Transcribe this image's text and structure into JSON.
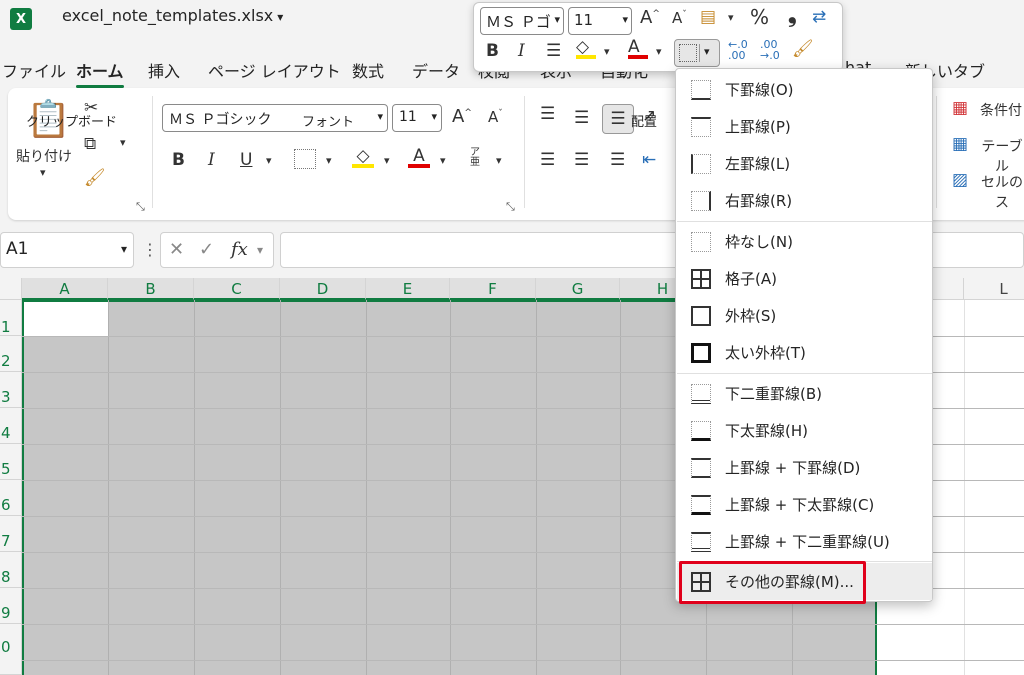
{
  "app": {
    "icon_letter": "X",
    "doc_title": "excel_note_templates.xlsx"
  },
  "tabs": [
    "ファイル",
    "ホーム",
    "挿入",
    "ページ レイアウト",
    "数式",
    "データ",
    "校閲",
    "表示",
    "自動化",
    "hat",
    "新しいタブ"
  ],
  "ribbon": {
    "clipboard_paste": "貼り付け",
    "clipboard_label": "クリップボード",
    "font_name": "ＭＳ Ｐゴシック",
    "font_size": "11",
    "font_label": "フォント",
    "align_label": "配置",
    "styles": [
      "条件付",
      "テーブル",
      "セルのス"
    ]
  },
  "formula_bar": {
    "name_box": "A1",
    "fx": "fx"
  },
  "grid": {
    "columns": [
      "A",
      "B",
      "C",
      "D",
      "E",
      "F",
      "G",
      "H",
      "L"
    ],
    "rows": [
      "1",
      "2",
      "3",
      "4",
      "5",
      "6",
      "7",
      "8",
      "9",
      "0"
    ]
  },
  "minibar": {
    "font_name": "ＭＳ Ｐゴ",
    "font_size": "11",
    "percent": "%",
    "comma": "❟",
    "inc_dec": ".00"
  },
  "menu": {
    "items": [
      {
        "label": "下罫線(O)",
        "icon": "bottom-border-icon"
      },
      {
        "label": "上罫線(P)",
        "icon": "top-border-icon"
      },
      {
        "label": "左罫線(L)",
        "icon": "left-border-icon"
      },
      {
        "label": "右罫線(R)",
        "icon": "right-border-icon"
      },
      {
        "label": "枠なし(N)",
        "icon": "no-border-icon"
      },
      {
        "label": "格子(A)",
        "icon": "all-borders-icon"
      },
      {
        "label": "外枠(S)",
        "icon": "outside-borders-icon"
      },
      {
        "label": "太い外枠(T)",
        "icon": "thick-outside-borders-icon"
      },
      {
        "label": "下二重罫線(B)",
        "icon": "bottom-double-border-icon"
      },
      {
        "label": "下太罫線(H)",
        "icon": "thick-bottom-border-icon"
      },
      {
        "label": "上罫線 + 下罫線(D)",
        "icon": "top-bottom-border-icon"
      },
      {
        "label": "上罫線 + 下太罫線(C)",
        "icon": "top-thick-bottom-border-icon"
      },
      {
        "label": "上罫線 + 下二重罫線(U)",
        "icon": "top-double-bottom-border-icon"
      },
      {
        "label": "その他の罫線(M)...",
        "icon": "more-borders-icon"
      }
    ]
  },
  "colors": {
    "accent": "#107c41",
    "highlight": "#e0001b",
    "fill_yellow": "#ffe600",
    "font_red": "#e00000"
  }
}
